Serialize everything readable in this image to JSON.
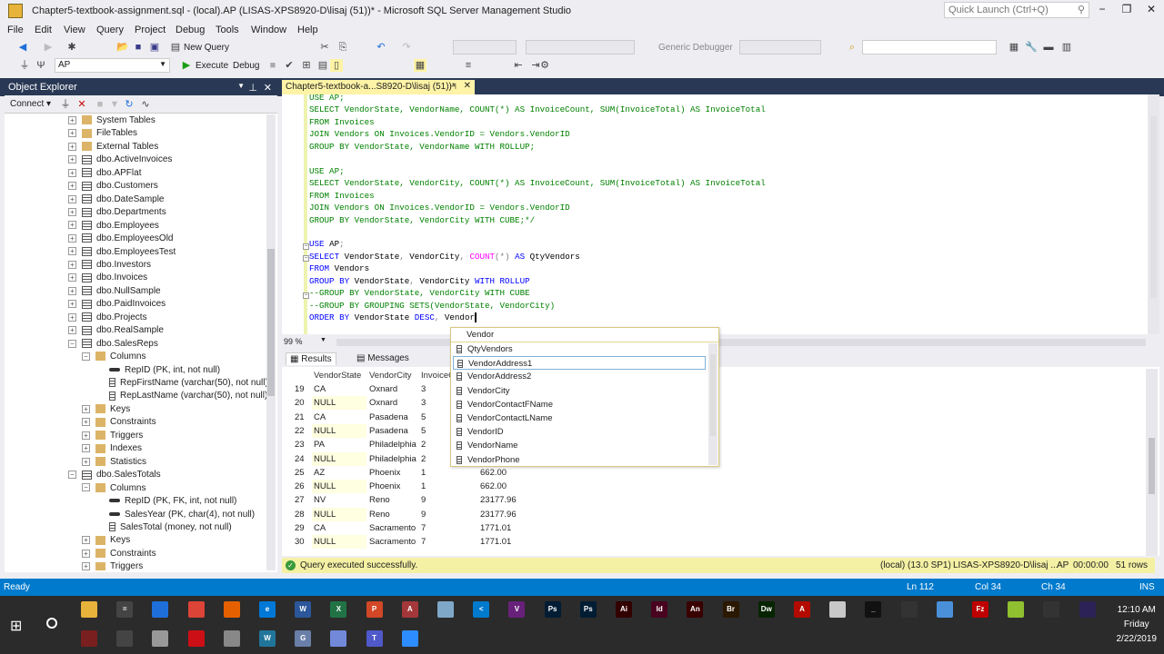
{
  "window": {
    "title": "Chapter5-textbook-assignment.sql - (local).AP (LISAS-XPS8920-D\\lisaj (51))* - Microsoft SQL Server Management Studio",
    "quick_launch_placeholder": "Quick Launch (Ctrl+Q)"
  },
  "menu": [
    "File",
    "Edit",
    "View",
    "Query",
    "Project",
    "Debug",
    "Tools",
    "Window",
    "Help"
  ],
  "toolbar": {
    "new_query": "New Query",
    "database": "AP",
    "execute": "Execute",
    "debug": "Debug",
    "debugger": "Generic Debugger"
  },
  "object_explorer": {
    "title": "Object Explorer",
    "connect": "Connect",
    "nodes": [
      {
        "label": "System Tables",
        "type": "folder",
        "level": 0,
        "exp": "+"
      },
      {
        "label": "FileTables",
        "type": "folder",
        "level": 0,
        "exp": "+"
      },
      {
        "label": "External Tables",
        "type": "folder",
        "level": 0,
        "exp": "+"
      },
      {
        "label": "dbo.ActiveInvoices",
        "type": "table",
        "level": 0,
        "exp": "+"
      },
      {
        "label": "dbo.APFlat",
        "type": "table",
        "level": 0,
        "exp": "+"
      },
      {
        "label": "dbo.Customers",
        "type": "table",
        "level": 0,
        "exp": "+"
      },
      {
        "label": "dbo.DateSample",
        "type": "table",
        "level": 0,
        "exp": "+"
      },
      {
        "label": "dbo.Departments",
        "type": "table",
        "level": 0,
        "exp": "+"
      },
      {
        "label": "dbo.Employees",
        "type": "table",
        "level": 0,
        "exp": "+"
      },
      {
        "label": "dbo.EmployeesOld",
        "type": "table",
        "level": 0,
        "exp": "+"
      },
      {
        "label": "dbo.EmployeesTest",
        "type": "table",
        "level": 0,
        "exp": "+"
      },
      {
        "label": "dbo.Investors",
        "type": "table",
        "level": 0,
        "exp": "+"
      },
      {
        "label": "dbo.Invoices",
        "type": "table",
        "level": 0,
        "exp": "+"
      },
      {
        "label": "dbo.NullSample",
        "type": "table",
        "level": 0,
        "exp": "+"
      },
      {
        "label": "dbo.PaidInvoices",
        "type": "table",
        "level": 0,
        "exp": "+"
      },
      {
        "label": "dbo.Projects",
        "type": "table",
        "level": 0,
        "exp": "+"
      },
      {
        "label": "dbo.RealSample",
        "type": "table",
        "level": 0,
        "exp": "+"
      },
      {
        "label": "dbo.SalesReps",
        "type": "table",
        "level": 0,
        "exp": "−"
      },
      {
        "label": "Columns",
        "type": "folder",
        "level": 1,
        "exp": "−"
      },
      {
        "label": "RepID (PK, int, not null)",
        "type": "key",
        "level": 2,
        "exp": ""
      },
      {
        "label": "RepFirstName (varchar(50), not null)",
        "type": "col",
        "level": 2,
        "exp": ""
      },
      {
        "label": "RepLastName (varchar(50), not null)",
        "type": "col",
        "level": 2,
        "exp": ""
      },
      {
        "label": "Keys",
        "type": "folder",
        "level": 1,
        "exp": "+"
      },
      {
        "label": "Constraints",
        "type": "folder",
        "level": 1,
        "exp": "+"
      },
      {
        "label": "Triggers",
        "type": "folder",
        "level": 1,
        "exp": "+"
      },
      {
        "label": "Indexes",
        "type": "folder",
        "level": 1,
        "exp": "+"
      },
      {
        "label": "Statistics",
        "type": "folder",
        "level": 1,
        "exp": "+"
      },
      {
        "label": "dbo.SalesTotals",
        "type": "table",
        "level": 0,
        "exp": "−"
      },
      {
        "label": "Columns",
        "type": "folder",
        "level": 1,
        "exp": "−"
      },
      {
        "label": "RepID (PK, FK, int, not null)",
        "type": "key",
        "level": 2,
        "exp": ""
      },
      {
        "label": "SalesYear (PK, char(4), not null)",
        "type": "key",
        "level": 2,
        "exp": ""
      },
      {
        "label": "SalesTotal (money, not null)",
        "type": "col",
        "level": 2,
        "exp": ""
      },
      {
        "label": "Keys",
        "type": "folder",
        "level": 1,
        "exp": "+"
      },
      {
        "label": "Constraints",
        "type": "folder",
        "level": 1,
        "exp": "+"
      },
      {
        "label": "Triggers",
        "type": "folder",
        "level": 1,
        "exp": "+"
      }
    ]
  },
  "editor": {
    "tab_title": "Chapter5-textbook-a...S8920-D\\lisaj (51))*",
    "lines": [
      [
        [
          "USE AP;",
          "cm"
        ]
      ],
      [
        [
          "SELECT VendorState, VendorName, COUNT(*) AS InvoiceCount, SUM(InvoiceTotal) AS InvoiceTotal",
          "cm"
        ]
      ],
      [
        [
          "FROM Invoices",
          "cm"
        ]
      ],
      [
        [
          "JOIN Vendors ON Invoices.VendorID = Vendors.VendorID",
          "cm"
        ]
      ],
      [
        [
          "GROUP BY VendorState, VendorName WITH ROLLUP;",
          "cm"
        ]
      ],
      [],
      [
        [
          "USE AP;",
          "cm"
        ]
      ],
      [
        [
          "SELECT VendorState, VendorCity, COUNT(*) AS InvoiceCount, SUM(InvoiceTotal) AS InvoiceTotal",
          "cm"
        ]
      ],
      [
        [
          "FROM Invoices",
          "cm"
        ]
      ],
      [
        [
          "JOIN Vendors ON Invoices.VendorID = Vendors.VendorID",
          "cm"
        ]
      ],
      [
        [
          "GROUP BY VendorState, VendorCity WITH CUBE;*/",
          "cm"
        ]
      ],
      [],
      [
        [
          "USE ",
          "kw"
        ],
        [
          "AP",
          "tx"
        ],
        [
          ";",
          "gr"
        ]
      ],
      [
        [
          "SELECT ",
          "kw"
        ],
        [
          "VendorState",
          "tx"
        ],
        [
          ", ",
          "gr"
        ],
        [
          "VendorCity",
          "tx"
        ],
        [
          ", ",
          "gr"
        ],
        [
          "COUNT",
          "fn"
        ],
        [
          "(*) ",
          "gr"
        ],
        [
          "AS ",
          "kw"
        ],
        [
          "QtyVendors",
          "tx"
        ]
      ],
      [
        [
          "FROM ",
          "kw"
        ],
        [
          "Vendors",
          "tx"
        ]
      ],
      [
        [
          "GROUP BY ",
          "kw"
        ],
        [
          "VendorState",
          "tx"
        ],
        [
          ", ",
          "gr"
        ],
        [
          "VendorCity ",
          "tx"
        ],
        [
          "WITH ROLLUP",
          "kw"
        ]
      ],
      [
        [
          "--GROUP BY VendorState, VendorCity WITH CUBE",
          "cm"
        ]
      ],
      [
        [
          "--GROUP BY GROUPING SETS(VendorState, VendorCity)",
          "cm"
        ]
      ],
      [
        [
          "ORDER BY ",
          "kw"
        ],
        [
          "VendorState ",
          "tx"
        ],
        [
          "DESC",
          "kw"
        ],
        [
          ", ",
          "gr"
        ],
        [
          "Vendor",
          "tx"
        ]
      ]
    ],
    "zoom": "99 %"
  },
  "autocomplete": {
    "typed": "Vendor",
    "items": [
      "QtyVendors",
      "VendorAddress1",
      "VendorAddress2",
      "VendorCity",
      "VendorContactFName",
      "VendorContactLName",
      "VendorID",
      "VendorName",
      "VendorPhone"
    ],
    "selected": "VendorAddress1"
  },
  "results": {
    "tabs": [
      "Results",
      "Messages"
    ],
    "columns": [
      "",
      "VendorState",
      "VendorCity",
      "InvoiceCount",
      "InvoiceTotal"
    ],
    "rows": [
      [
        "19",
        "CA",
        "Oxnard",
        "3",
        ""
      ],
      [
        "20",
        "NULL",
        "Oxnard",
        "3",
        ""
      ],
      [
        "21",
        "CA",
        "Pasadena",
        "5",
        ""
      ],
      [
        "22",
        "NULL",
        "Pasadena",
        "5",
        ""
      ],
      [
        "23",
        "PA",
        "Philadelphia",
        "2",
        ""
      ],
      [
        "24",
        "NULL",
        "Philadelphia",
        "2",
        ""
      ],
      [
        "25",
        "AZ",
        "Phoenix",
        "1",
        "662.00"
      ],
      [
        "26",
        "NULL",
        "Phoenix",
        "1",
        "662.00"
      ],
      [
        "27",
        "NV",
        "Reno",
        "9",
        "23177.96"
      ],
      [
        "28",
        "NULL",
        "Reno",
        "9",
        "23177.96"
      ],
      [
        "29",
        "CA",
        "Sacramento",
        "7",
        "1771.01"
      ],
      [
        "30",
        "NULL",
        "Sacramento",
        "7",
        "1771.01"
      ]
    ]
  },
  "query_status": {
    "message": "Query executed successfully.",
    "server": "(local) (13.0 SP1)",
    "user": "LISAS-XPS8920-D\\lisaj ...",
    "db": "AP",
    "time": "00:00:00",
    "rows": "51 rows"
  },
  "statusbar": {
    "state": "Ready",
    "ln": "Ln 112",
    "col": "Col 34",
    "ch": "Ch 34",
    "mode": "INS"
  },
  "taskbar": {
    "time": "12:10 AM",
    "day": "Friday",
    "date": "2/22/2019",
    "row1": [
      [
        "file-explorer",
        "#e8b33a",
        ""
      ],
      [
        "calculator",
        "#444",
        "="
      ],
      [
        "store",
        "#1e6fd9",
        ""
      ],
      [
        "chrome",
        "#db4437",
        ""
      ],
      [
        "firefox",
        "#e66000",
        ""
      ],
      [
        "edge",
        "#0078d7",
        "e"
      ],
      [
        "word",
        "#2b579a",
        "W"
      ],
      [
        "excel",
        "#217346",
        "X"
      ],
      [
        "powerpoint",
        "#d24726",
        "P"
      ],
      [
        "access",
        "#a4373a",
        "A"
      ],
      [
        "app",
        "#7fa8c8",
        ""
      ],
      [
        "vscode",
        "#007acc",
        "<"
      ],
      [
        "visual-studio",
        "#68217a",
        "V"
      ],
      [
        "photoshop",
        "#001d34",
        "Ps"
      ],
      [
        "photoshop-2",
        "#001d34",
        "Ps"
      ],
      [
        "illustrator",
        "#330000",
        "Ai"
      ],
      [
        "indesign",
        "#49021f",
        "Id"
      ],
      [
        "animate",
        "#3a0000",
        "An"
      ],
      [
        "bridge",
        "#2b1800",
        "Br"
      ],
      [
        "dreamweaver",
        "#072401",
        "Dw"
      ],
      [
        "acrobat",
        "#b30b00",
        "A"
      ],
      [
        "ssms",
        "#c8c8c8",
        ""
      ],
      [
        "terminal",
        "#111",
        "_"
      ],
      [
        "app-2",
        "#333",
        ""
      ],
      [
        "app-3",
        "#4a90d9",
        ""
      ],
      [
        "filezilla",
        "#bf0000",
        "Fz"
      ],
      [
        "notepad-plus",
        "#90c030",
        ""
      ],
      [
        "inkscape",
        "#333",
        ""
      ],
      [
        "eclipse",
        "#2c2255",
        ""
      ]
    ],
    "row2": [
      [
        "app-4",
        "#7a1f1f",
        ""
      ],
      [
        "app-5",
        "#444",
        ""
      ],
      [
        "app-6",
        "#999",
        ""
      ],
      [
        "opera",
        "#cc0f16",
        ""
      ],
      [
        "app-7",
        "#888",
        ""
      ],
      [
        "wordpress",
        "#21759b",
        "W"
      ],
      [
        "gms",
        "#6a7fa8",
        "G"
      ],
      [
        "discord",
        "#7289da",
        ""
      ],
      [
        "teams",
        "#5059c9",
        "T"
      ],
      [
        "zoom",
        "#2d8cff",
        ""
      ]
    ]
  }
}
